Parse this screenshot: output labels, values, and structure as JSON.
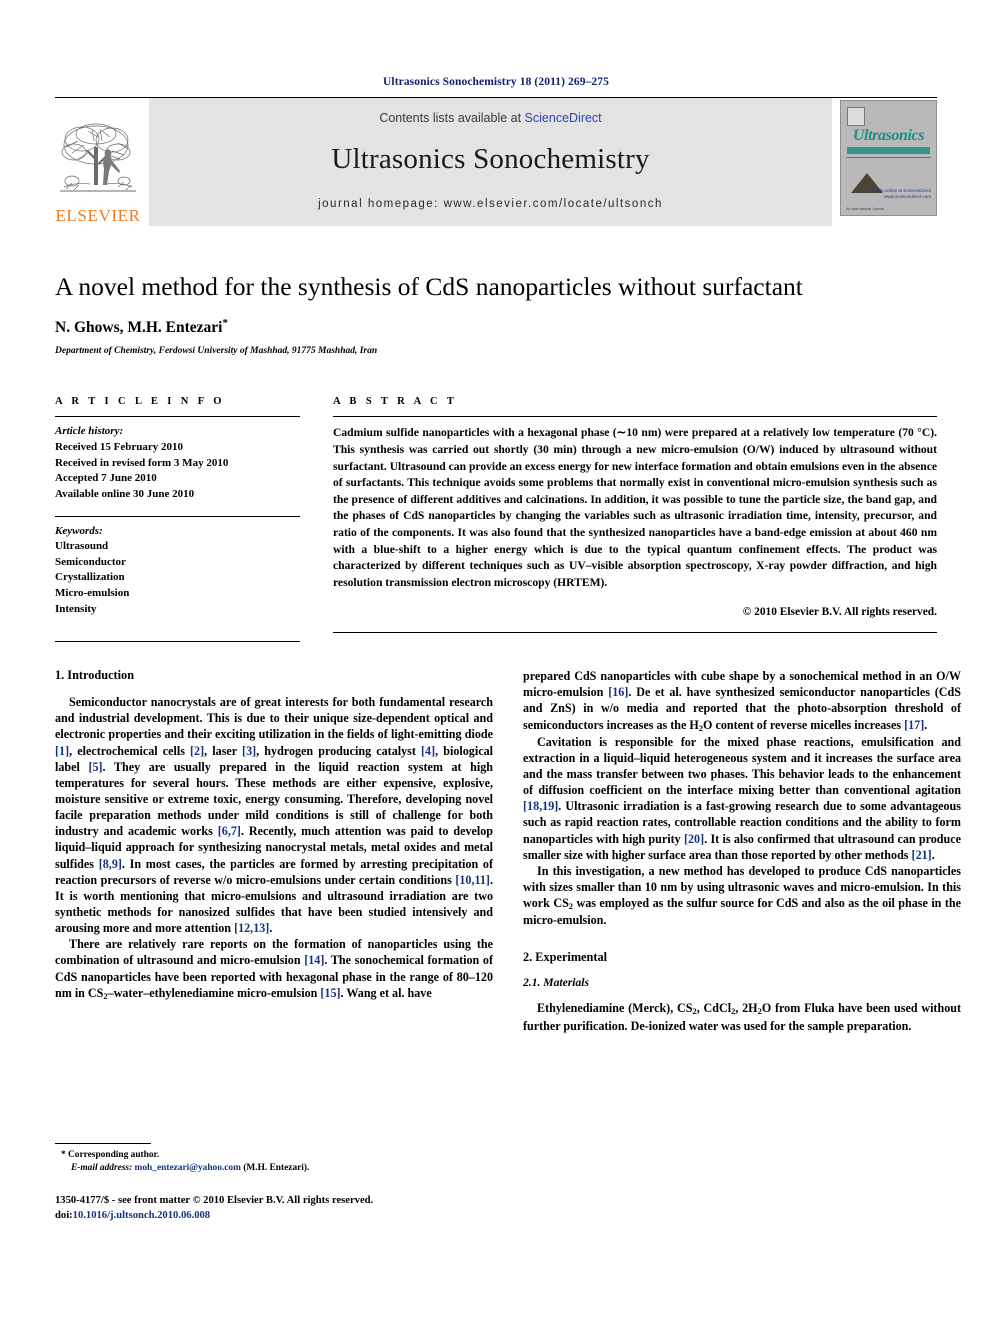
{
  "running_head": "Ultrasonics Sonochemistry 18 (2011) 269–275",
  "masthead": {
    "publisher_word": "ELSEVIER",
    "contents_prefix": "Contents lists available at ",
    "sciencedirect": "ScienceDirect",
    "journal_name": "Ultrasonics Sonochemistry",
    "homepage": "journal homepage: www.elsevier.com/locate/ultsonch",
    "cover": {
      "script_title": "Ultrasonics",
      "script_sub": "SONOCHEMISTRY",
      "sd_note": "Available online at\nScienceDirect\nwww.sciencedirect.com",
      "bottom_note": "An International Journal"
    }
  },
  "article": {
    "title": "A novel method for the synthesis of CdS nanoparticles without surfactant",
    "authors": "N. Ghows, M.H. Entezari",
    "corresponding_marker": "*",
    "affiliation": "Department of Chemistry, Ferdowsi University of Mashhad, 91775 Mashhad, Iran"
  },
  "article_info": {
    "heading": "A R T I C L E   I N F O",
    "history_label": "Article history:",
    "history": [
      "Received 15 February 2010",
      "Received in revised form 3 May 2010",
      "Accepted 7 June 2010",
      "Available online 30 June 2010"
    ],
    "keywords_label": "Keywords:",
    "keywords": [
      "Ultrasound",
      "Semiconductor",
      "Crystallization",
      "Micro-emulsion",
      "Intensity"
    ]
  },
  "abstract": {
    "heading": "A B S T R A C T",
    "text": "Cadmium sulfide nanoparticles with a hexagonal phase (∼10 nm) were prepared at a relatively low temperature (70 °C). This synthesis was carried out shortly (30 min) through a new micro-emulsion (O/W) induced by ultrasound without surfactant. Ultrasound can provide an excess energy for new interface formation and obtain emulsions even in the absence of surfactants. This technique avoids some problems that normally exist in conventional micro-emulsion synthesis such as the presence of different additives and calcinations. In addition, it was possible to tune the particle size, the band gap, and the phases of CdS nanoparticles by changing the variables such as ultrasonic irradiation time, intensity, precursor, and ratio of the components. It was also found that the synthesized nanoparticles have a band-edge emission at about 460 nm with a blue-shift to a higher energy which is due to the typical quantum confinement effects. The product was characterized by different techniques such as UV–visible absorption spectroscopy, X-ray powder diffraction, and high resolution transmission electron microscopy (HRTEM).",
    "copyright": "© 2010 Elsevier B.V. All rights reserved."
  },
  "sections": {
    "introduction_heading": "1. Introduction",
    "experimental_heading": "2. Experimental",
    "materials_heading": "2.1. Materials"
  },
  "left_column": {
    "p1": "Semiconductor nanocrystals are of great interests for both fundamental research and industrial development. This is due to their unique size-dependent optical and electronic properties and their exciting utilization in the fields of light-emitting diode [1], electrochemical cells [2], laser [3], hydrogen producing catalyst [4], biological label [5]. They are usually prepared in the liquid reaction system at high temperatures for several hours. These methods are either expensive, explosive, moisture sensitive or extreme toxic, energy consuming. Therefore, developing novel facile preparation methods under mild conditions is still of challenge for both industry and academic works [6,7]. Recently, much attention was paid to develop liquid–liquid approach for synthesizing nanocrystal metals, metal oxides and metal sulfides [8,9]. In most cases, the particles are formed by arresting precipitation of reaction precursors of reverse w/o micro-emulsions under certain conditions [10,11]. It is worth mentioning that micro-emulsions and ultrasound irradiation are two synthetic methods for nanosized sulfides that have been studied intensively and arousing more and more attention [12,13].",
    "p2": "There are relatively rare reports on the formation of nanoparticles using the combination of ultrasound and micro-emulsion [14]. The sonochemical formation of CdS nanoparticles have been reported with hexagonal phase in the range of 80–120 nm in CS2–water–ethylenediamine micro-emulsion [15]. Wang et al. have"
  },
  "right_column": {
    "p1": "prepared CdS nanoparticles with cube shape by a sonochemical method in an O/W micro-emulsion [16]. De et al. have synthesized semiconductor nanoparticles (CdS and ZnS) in w/o media and reported that the photo-absorption threshold of semiconductors increases as the H2O content of reverse micelles increases [17].",
    "p2": "Cavitation is responsible for the mixed phase reactions, emulsification and extraction in a liquid–liquid heterogeneous system and it increases the surface area and the mass transfer between two phases. This behavior leads to the enhancement of diffusion coefficient on the interface mixing better than conventional agitation [18,19]. Ultrasonic irradiation is a fast-growing research due to some advantageous such as rapid reaction rates, controllable reaction conditions and the ability to form nanoparticles with high purity [20]. It is also confirmed that ultrasound can produce smaller size with higher surface area than those reported by other methods [21].",
    "p3": "In this investigation, a new method has developed to produce CdS nanoparticles with sizes smaller than 10 nm by using ultrasonic waves and micro-emulsion. In this work CS2 was employed as the sulfur source for CdS and also as the oil phase in the micro-emulsion.",
    "p4": "Ethylenediamine (Merck), CS2, CdCl2, 2H2O from Fluka have been used without further purification. De-ionized water was used for the sample preparation."
  },
  "footnotes": {
    "corresponding_author": "Corresponding author.",
    "email_label": "E-mail address:",
    "email": "moh_entezari@yahoo.com",
    "email_suffix": "(M.H. Entezari)."
  },
  "imprint": {
    "issn_line": "1350-4177/$ - see front matter © 2010 Elsevier B.V. All rights reserved.",
    "doi_label": "doi:",
    "doi": "10.1016/j.ultsonch.2010.06.008"
  },
  "colors": {
    "running_head": "#14216b",
    "elsevier_orange": "#ef7d24",
    "link_blue": "#2b46b4",
    "ref_blue": "#17317f",
    "band_grey": "#e3e3e3",
    "cover_teal": "#1f8e84"
  }
}
